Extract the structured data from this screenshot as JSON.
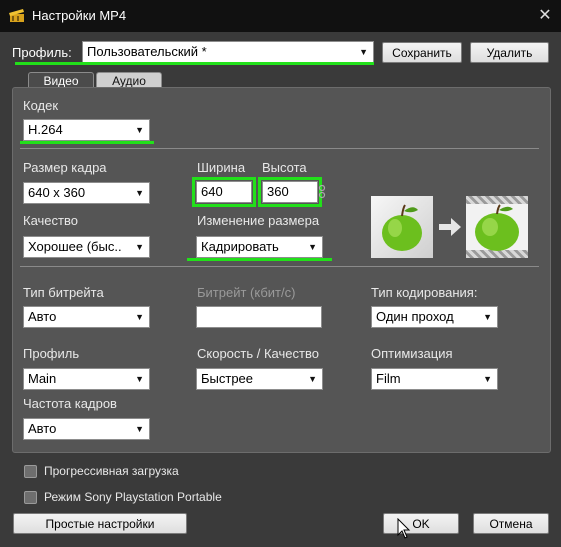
{
  "window": {
    "title": "Настройки MP4",
    "close_glyph": "✕"
  },
  "profile": {
    "label": "Профиль:",
    "value": "Пользовательский *",
    "save_button": "Сохранить",
    "delete_button": "Удалить"
  },
  "tabs": [
    {
      "label": "Видео",
      "active": true
    },
    {
      "label": "Аудио",
      "active": false
    }
  ],
  "video": {
    "codec": {
      "label": "Кодек",
      "value": "H.264"
    },
    "frame_size": {
      "label": "Размер кадра",
      "value": "640 x 360"
    },
    "width": {
      "label": "Ширина",
      "value": "640"
    },
    "height": {
      "label": "Высота",
      "value": "360"
    },
    "quality": {
      "label": "Качество",
      "value": "Хорошее (быс.."
    },
    "resize": {
      "label": "Изменение размера",
      "value": "Кадрировать"
    },
    "bitrate_type": {
      "label": "Тип битрейта",
      "value": "Авто"
    },
    "bitrate": {
      "label": "Битрейт (кбит/с)",
      "value": ""
    },
    "encoding_type": {
      "label": "Тип кодирования:",
      "value": "Один проход"
    },
    "profile": {
      "label": "Профиль",
      "value": "Main"
    },
    "speed_quality": {
      "label": "Скорость / Качество",
      "value": "Быстрее"
    },
    "optimization": {
      "label": "Оптимизация",
      "value": "Film"
    },
    "frame_rate": {
      "label": "Частота кадров",
      "value": "Авто"
    }
  },
  "options": {
    "progressive": {
      "label": "Прогрессивная загрузка",
      "checked": false
    },
    "psp": {
      "label": "Режим Sony Playstation Portable",
      "checked": false
    }
  },
  "footer": {
    "simple_settings": "Простые настройки",
    "ok": "OK",
    "cancel": "Отмена"
  },
  "colors": {
    "highlight": "#22e01a",
    "background": "#3a3a3a",
    "panel": "#555555",
    "titlebar": "#111111"
  },
  "icons": {
    "window_icon": "film-clapper-icon",
    "preview": "apple-icon",
    "arrow": "arrow-right-icon",
    "cursor": "mouse-cursor-icon"
  }
}
